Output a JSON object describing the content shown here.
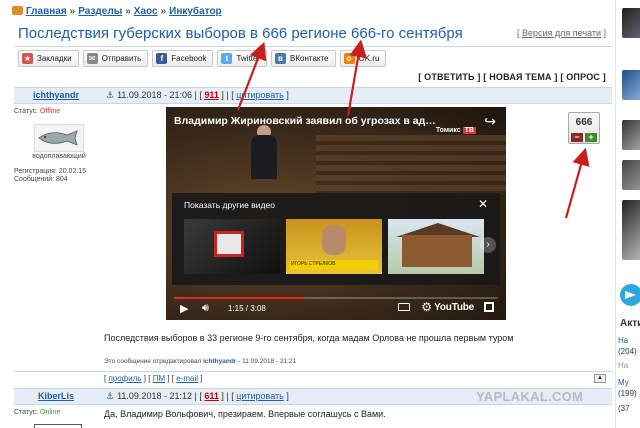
{
  "breadcrumb": {
    "items": [
      "Главная",
      "Разделы",
      "Хаос",
      "Инкубатор"
    ],
    "separator": "»"
  },
  "topic": {
    "title": "Последствия губерских выборов в 666 регионе 666-го сентября",
    "print_version": "Версия для печати"
  },
  "share": {
    "buttons": [
      {
        "label": "Закладки",
        "icon": "bookmark-icon",
        "color": "#d9534f"
      },
      {
        "label": "Отправить",
        "icon": "mail-icon",
        "color": "#888888"
      },
      {
        "label": "Facebook",
        "icon": "facebook-icon",
        "color": "#3b5998"
      },
      {
        "label": "Twitter",
        "icon": "twitter-icon",
        "color": "#55acee"
      },
      {
        "label": "ВКонтакте",
        "icon": "vk-icon",
        "color": "#4a76a8"
      },
      {
        "label": "OK.ru",
        "icon": "ok-icon",
        "color": "#ee8208"
      }
    ]
  },
  "actions": {
    "reply": "ОТВЕТИТЬ",
    "new_topic": "НОВАЯ ТЕМА",
    "poll": "ОПРОС"
  },
  "post1": {
    "author": "ichthyandr",
    "datetime": "11.09.2018 - 21:06",
    "number": "911",
    "quote": "цитировать",
    "status_label": "Статус:",
    "status": "Offline",
    "user_title": "водоплавающий",
    "reg_label": "Регистрация:",
    "reg_date": "20.02.15",
    "msgs_label": "Сообщений:",
    "msgs": "804",
    "rating": "666",
    "rating_minus": "−",
    "rating_plus": "+",
    "text": "Последствия выборов в 33 регионе 9-го сентября, когда мадам Орлова не прошла первым туром",
    "edit_prefix": "Это сообщение отредактировал",
    "edit_user": "ichthyandr",
    "edit_time": "11.09.2018 - 21:21",
    "links": [
      "профиль",
      "ПМ",
      "e-mail"
    ]
  },
  "video": {
    "title": "Владимир Жириновский заявил об угрозах в адрес ...",
    "channel": "Томикс",
    "channel_suffix": "ТВ",
    "more_videos": "Показать другие видео",
    "time_current": "1:15",
    "time_total": "3:08",
    "time_sep": " / ",
    "progress": 0.4,
    "brand": "YouTube",
    "thumb2_caption": "ИГОРЬ СТРЕЛКОВ"
  },
  "post2": {
    "author": "KiberLis",
    "datetime": "11.09.2018 - 21:12",
    "number": "611",
    "quote": "цитировать",
    "status_label": "Статус:",
    "status": "Online",
    "text": "Да, Владимир Вольфович, презираем. Впервые соглашусь с Вами."
  },
  "watermark": "YAPLAKAL.COM",
  "sidebar": {
    "heading": "Акти",
    "items": [
      {
        "label": "На",
        "count": "(204)"
      },
      {
        "label": "На",
        "count": ""
      },
      {
        "label": "Му",
        "count": "(199)"
      },
      {
        "label": "(37",
        "count": ""
      }
    ]
  },
  "colors": {
    "link": "#1f5ea8",
    "header_bg": "#e6edf5",
    "online": "#2f9e2f",
    "offline": "#cc3333",
    "annotation_arrow": "#c81e1e"
  }
}
